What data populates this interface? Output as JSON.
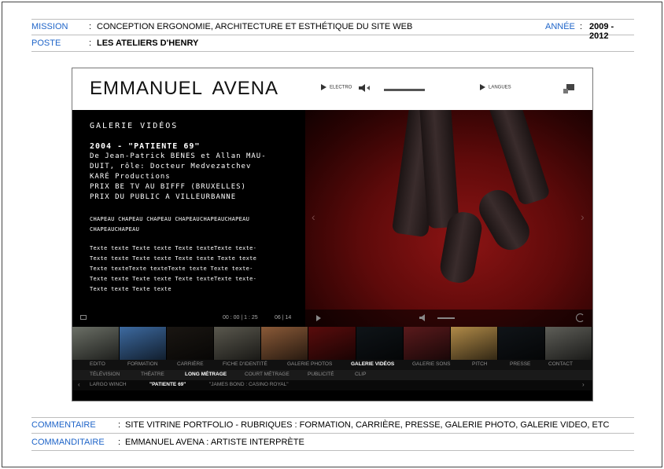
{
  "meta": {
    "mission_label": "MISSION",
    "mission_value": "CONCEPTION ERGONOMIE, ARCHITECTURE ET ESTHÉTIQUE DU SITE WEB",
    "annee_label": "ANNÉE",
    "annee_value": "2009 - 2012",
    "poste_label": "POSTE",
    "poste_value": "LES ATELIERS D'HENRY",
    "colon": ":"
  },
  "footer": {
    "commentaire_label": "COMMENTAIRE",
    "commentaire_value": "SITE VITRINE PORTFOLIO - RUBRIQUES : FORMATION, CARRIÈRE, PRESSE, GALERIE PHOTO, GALERIE VIDEO, ETC",
    "commanditaire_label": "COMMANDITAIRE",
    "commanditaire_value": "EMMANUEL AVENA : ARTISTE INTERPRÈTE"
  },
  "site": {
    "name": "EMMANUEL  AVENA",
    "electro_label": "ELECTRO",
    "langues_label": "LANGUES",
    "gallery_title": "GALERIE VIDÉOS",
    "film_title": "2004 - \"PATIENTE 69\"",
    "film_lines": [
      "De Jean-Patrick BENES et Allan MAU-",
      "DUIT, rôle: Docteur Medvezatchev",
      "KARÉ Productions",
      "PRIX BE TV AU BIFFF (BRUXELLES)",
      "PRIX DU PUBLIC A VILLEURBANNE"
    ],
    "chapeau": "CHAPEAU CHAPEAU CHAPEAU CHAPEAUCHAPEAUCHAPEAU CHAPEAUCHAPEAU",
    "texte_lines": [
      "Texte texte Texte texte Texte texteTexte texte-",
      "Texte texte Texte texte Texte texte Texte texte",
      "Texte texteTexte texteTexte texte Texte texte-",
      "Texte texte Texte texte Texte texteTexte texte-",
      "Texte texte Texte texte"
    ],
    "time_elapsed": "00 : 00",
    "time_total": "1 : 25",
    "page_current": "06",
    "page_total": "14",
    "nav_main": [
      "EDITO",
      "FORMATION",
      "CARRIÈRE",
      "FICHE D'IDENTITÉ",
      "GALERIE PHOTOS",
      "GALERIE VIDÉOS",
      "GALERIE SONS",
      "PITCH",
      "PRESSE",
      "CONTACT"
    ],
    "nav_sub": [
      "TÉLÉVISION",
      "THÉATRE",
      "LONG MÉTRAGE",
      "COURT MÉTRAGE",
      "PUBLICITÉ",
      "CLIP"
    ],
    "nav_films": [
      "LARGO WINCH",
      "\"PATIENTE 69\"",
      "\"JAMES BOND : CASINO ROYAL\""
    ],
    "thumb_colors": [
      "#6b6f66",
      "#3d6aa0",
      "#1a1612",
      "#5a584e",
      "#8a5a38",
      "#5a0c0c",
      "#0f1418",
      "#5a1a1c",
      "#b08a48",
      "#101418",
      "#5e5e58"
    ]
  }
}
